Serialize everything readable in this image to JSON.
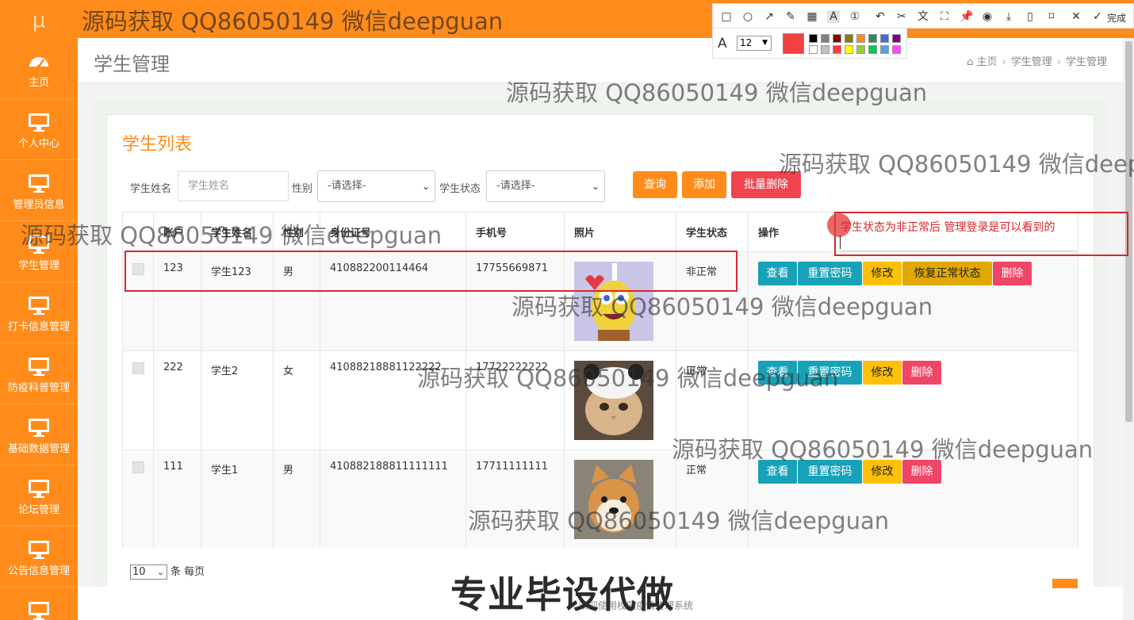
{
  "logo": "μ",
  "watermark": "源码获取 QQ86050149 微信deepguan",
  "sidebar": {
    "items": [
      {
        "label": "主页",
        "icon": "dashboard-icon"
      },
      {
        "label": "个人中心",
        "icon": "monitor-icon"
      },
      {
        "label": "管理员信息",
        "icon": "monitor-icon"
      },
      {
        "label": "学生管理",
        "icon": "monitor-icon"
      },
      {
        "label": "打卡信息管理",
        "icon": "monitor-icon"
      },
      {
        "label": "防疫科普管理",
        "icon": "monitor-icon"
      },
      {
        "label": "基础数据管理",
        "icon": "monitor-icon"
      },
      {
        "label": "论坛管理",
        "icon": "monitor-icon"
      },
      {
        "label": "公告信息管理",
        "icon": "monitor-icon"
      },
      {
        "label": "",
        "icon": "monitor-icon"
      }
    ]
  },
  "header": {
    "title": "学生管理",
    "breadcrumb": [
      "主页",
      "学生管理",
      "学生管理"
    ]
  },
  "panel": {
    "title": "学生列表"
  },
  "search": {
    "name_label": "学生姓名",
    "name_placeholder": "学生姓名",
    "gender_label": "性别",
    "gender_value": "-请选择-",
    "status_label": "学生状态",
    "status_value": "-请选择-",
    "query_btn": "查询",
    "add_btn": "添加",
    "batch_delete_btn": "批量删除"
  },
  "table": {
    "headers": [
      "账户",
      "学生姓名",
      "性别",
      "身份证号",
      "手机号",
      "照片",
      "学生状态",
      "操作"
    ],
    "rows": [
      {
        "account": "123",
        "name": "学生123",
        "gender": "男",
        "id_card": "410882200114464",
        "phone": "17755669871",
        "photo": "spongebob-photo",
        "status": "非正常",
        "actions": [
          "查看",
          "重置密码",
          "修改",
          "恢复正常状态",
          "删除"
        ]
      },
      {
        "account": "222",
        "name": "学生2",
        "gender": "女",
        "id_card": "41088218881122222",
        "phone": "17722222222",
        "photo": "cat-photo",
        "status": "正常",
        "actions": [
          "查看",
          "重置密码",
          "修改",
          "删除"
        ]
      },
      {
        "account": "111",
        "name": "学生1",
        "gender": "男",
        "id_card": "410882188811111111",
        "phone": "17711111111",
        "photo": "shiba-photo",
        "status": "正常",
        "actions": [
          "查看",
          "重置密码",
          "修改",
          "删除"
        ]
      }
    ]
  },
  "pager": {
    "page_size": "10",
    "label": "条 每页"
  },
  "annotation": {
    "note": "学生状态为非正常后 管理登录是可以看到的",
    "font_size": "12",
    "done_label": "完成",
    "colors": {
      "accent": "#ff8c1a",
      "selected_color": "#f24141",
      "row1": [
        "#000000",
        "#808080",
        "#8b0000",
        "#808000",
        "#ff8c1a",
        "#2e8b57",
        "#4169e1",
        "#800080",
        "#008b8b"
      ],
      "row2": [
        "#ffffff",
        "#c0c0c0",
        "#ff3b3b",
        "#ffff00",
        "#9acd32",
        "#00c853",
        "#4fa3e0",
        "#ff44ff",
        "#00e5e5"
      ]
    }
  },
  "banner": "专业毕设代做",
  "footer": "欢迎使用校园疫情管理系统"
}
